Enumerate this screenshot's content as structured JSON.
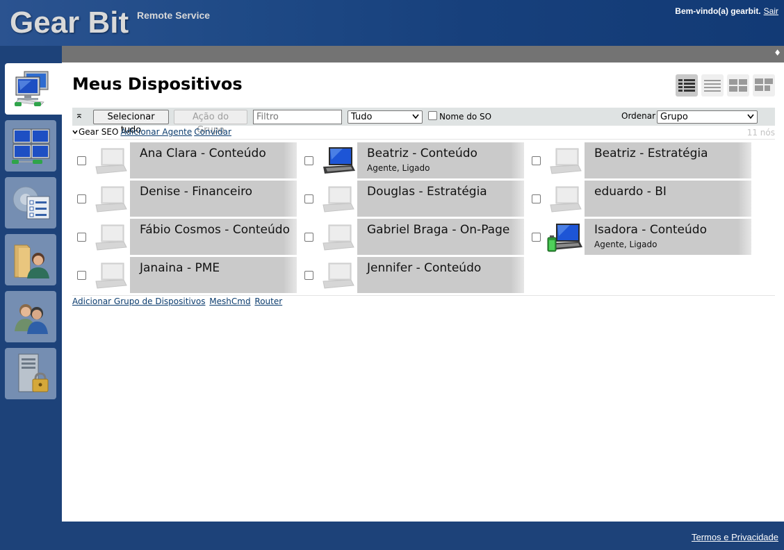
{
  "header": {
    "brand": "Gear Bit",
    "brand_sub": "Remote Service",
    "welcome": "Bem-vindo(a) gearbit.",
    "logout": "Sair"
  },
  "graybar": {
    "glyph": "♦"
  },
  "nav": [
    {
      "name": "my-devices",
      "icon": "computers-network-icon",
      "active": true
    },
    {
      "name": "my-server-computers",
      "icon": "desktops-grid-icon",
      "active": false
    },
    {
      "name": "my-events",
      "icon": "settings-checklist-icon",
      "active": false
    },
    {
      "name": "my-files",
      "icon": "folder-user-icon",
      "active": false
    },
    {
      "name": "my-users",
      "icon": "users-icon",
      "active": false
    },
    {
      "name": "my-server",
      "icon": "server-lock-icon",
      "active": false
    }
  ],
  "main": {
    "title": "Meus Dispositivos",
    "view_modes": [
      "view-list-detailed",
      "view-list",
      "view-grid",
      "view-tiles"
    ]
  },
  "toolbar": {
    "collapse_glyph": "⌅",
    "select_all": "Selecionar tudo",
    "group_action": "Ação do Grupo",
    "filter_placeholder": "Filtro",
    "filter_type": "Tudo",
    "os_name_label": "Nome do SO",
    "sort_label": "Ordenar",
    "sort_value": "Grupo"
  },
  "group": {
    "name": "Gear SEO",
    "add_agent": "Adicionar Agente",
    "invite": "Convidar",
    "node_count": "11 nós"
  },
  "devices": [
    {
      "name": "Ana Clara - Conteúdo",
      "status": "",
      "online": false,
      "battery": false
    },
    {
      "name": "Beatriz - Conteúdo",
      "status": "Agente, Ligado",
      "online": true,
      "battery": false
    },
    {
      "name": "Beatriz - Estratégia",
      "status": "",
      "online": false,
      "battery": false
    },
    {
      "name": "Denise - Financeiro",
      "status": "",
      "online": false,
      "battery": false
    },
    {
      "name": "Douglas - Estratégia",
      "status": "",
      "online": false,
      "battery": false
    },
    {
      "name": "eduardo - BI",
      "status": "",
      "online": false,
      "battery": false
    },
    {
      "name": "Fábio Cosmos - Conteúdo",
      "status": "",
      "online": false,
      "battery": false
    },
    {
      "name": "Gabriel Braga - On-Page",
      "status": "",
      "online": false,
      "battery": false
    },
    {
      "name": "Isadora - Conteúdo",
      "status": "Agente, Ligado",
      "online": true,
      "battery": true
    },
    {
      "name": "Janaina - PME",
      "status": "",
      "online": false,
      "battery": false
    },
    {
      "name": "Jennifer - Conteúdo",
      "status": "",
      "online": false,
      "battery": false
    }
  ],
  "bottom_links": {
    "add_group": "Adicionar Grupo de Dispositivos",
    "meshcmd": "MeshCmd",
    "router": "Router"
  },
  "footer": {
    "terms": "Termos e Privacidade"
  },
  "colors": {
    "header_blue": "#1d4279",
    "tile_gray": "#cacaca",
    "link_blue": "#0b3c6e"
  }
}
